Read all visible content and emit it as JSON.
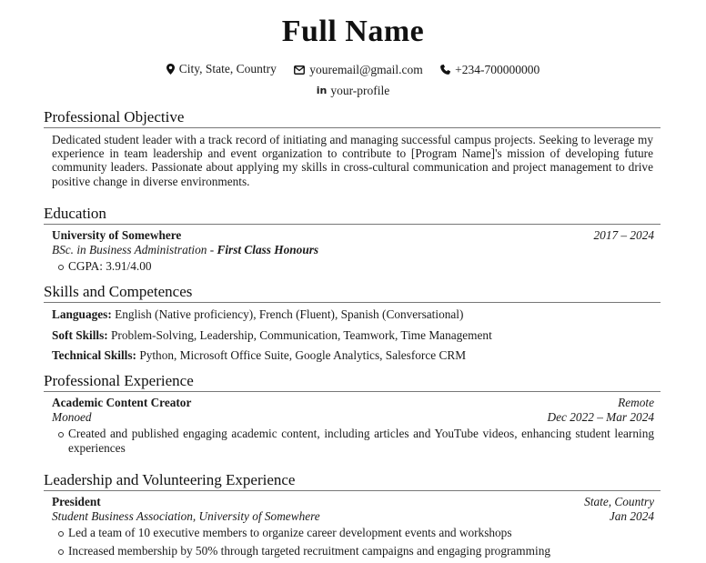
{
  "header": {
    "name": "Full Name",
    "contacts": [
      {
        "icon": "map-pin-icon",
        "text": "City, State, Country"
      },
      {
        "icon": "envelope-icon",
        "text": "youremail@gmail.com"
      },
      {
        "icon": "phone-icon",
        "text": "+234-700000000"
      },
      {
        "icon": "linkedin-icon",
        "text": "your-profile"
      }
    ]
  },
  "objective": {
    "title": "Professional Objective",
    "text": "Dedicated student leader with a track record of initiating and managing successful campus projects. Seeking to leverage my experience in team leadership and event organization to contribute to [Program Name]'s mission of developing future community leaders. Passionate about applying my skills in cross-cultural communication and project management to drive positive change in diverse environments."
  },
  "education": {
    "title": "Education",
    "entries": [
      {
        "institution": "University of Somewhere",
        "dates": "2017 – 2024",
        "degree": "BSc. in Business Administration",
        "separator": " - ",
        "honours": "First Class Honours",
        "bullets": [
          "CGPA: 3.91/4.00"
        ]
      }
    ]
  },
  "skills": {
    "title": "Skills and Competences",
    "items": [
      {
        "label": "Languages:",
        "value": "English (Native proficiency), French (Fluent), Spanish (Conversational)"
      },
      {
        "label": "Soft Skills:",
        "value": "Problem-Solving, Leadership, Communication, Teamwork, Time Management"
      },
      {
        "label": "Technical Skills:",
        "value": "Python, Microsoft Office Suite, Google Analytics, Salesforce CRM"
      }
    ]
  },
  "experience": {
    "title": "Professional Experience",
    "entries": [
      {
        "role": "Academic Content Creator",
        "location": "Remote",
        "organization": "Monoed",
        "dates": "Dec 2022 – Mar 2024",
        "bullets": [
          "Created and published engaging academic content, including articles and YouTube videos, enhancing student learning experiences"
        ]
      }
    ]
  },
  "leadership": {
    "title": "Leadership and Volunteering Experience",
    "entries": [
      {
        "role": "President",
        "location": "State, Country",
        "organization": "Student Business Association, University of Somewhere",
        "dates": "Jan 2024",
        "bullets": [
          "Led a team of 10 executive members to organize career development events and workshops",
          "Increased membership by 50% through targeted recruitment campaigns and engaging programming"
        ]
      }
    ]
  }
}
